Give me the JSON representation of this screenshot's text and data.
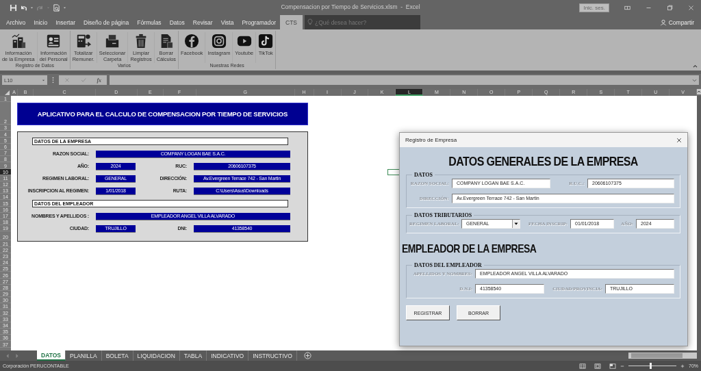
{
  "window": {
    "title": "Compensacion por Tiempo de Servicios.xlsm  -  Excel",
    "sign_in": "Inic. ses."
  },
  "menu_tabs": [
    {
      "label": "Archivo",
      "selected": false
    },
    {
      "label": "Inicio",
      "selected": false
    },
    {
      "label": "Insertar",
      "selected": false
    },
    {
      "label": "Diseño de página",
      "selected": false
    },
    {
      "label": "Fórmulas",
      "selected": false
    },
    {
      "label": "Datos",
      "selected": false
    },
    {
      "label": "Revisar",
      "selected": false
    },
    {
      "label": "Vista",
      "selected": false
    },
    {
      "label": "Programador",
      "selected": false
    },
    {
      "label": "CTS",
      "selected": true
    }
  ],
  "search": {
    "placeholder": "¿Qué desea hacer?"
  },
  "share": "Compartir",
  "ribbon": {
    "groups": [
      {
        "label": "Registro de Datos",
        "buttons": [
          {
            "lines": [
              "Información",
              "de la Empresa"
            ]
          },
          {
            "lines": [
              "Información",
              "del Personal"
            ]
          }
        ]
      },
      {
        "label": "Varios",
        "buttons": [
          {
            "lines": [
              "Totalizar",
              "Remuner."
            ]
          },
          {
            "lines": [
              "Seleccionar",
              "Carpeta"
            ]
          },
          {
            "lines": [
              "Limpiar",
              "Registros"
            ]
          },
          {
            "lines": [
              "Borrar",
              "Cálculos"
            ]
          }
        ]
      },
      {
        "label": "Nuestras Redes",
        "buttons": [
          {
            "lines": [
              "Facebook"
            ]
          },
          {
            "lines": [
              "Instagram"
            ]
          },
          {
            "lines": [
              "Youtube"
            ]
          },
          {
            "lines": [
              "TikTok"
            ]
          }
        ]
      }
    ]
  },
  "formula_bar": {
    "name_box": "L10",
    "function_label": "fx"
  },
  "sheet": {
    "columns": [
      {
        "label": "A",
        "selected": false
      },
      {
        "label": "B",
        "selected": false
      },
      {
        "label": "C",
        "selected": false
      },
      {
        "label": "D",
        "selected": false
      },
      {
        "label": "E",
        "selected": false
      },
      {
        "label": "F",
        "selected": false
      },
      {
        "label": "G",
        "selected": false
      },
      {
        "label": "H",
        "selected": false
      },
      {
        "label": "I",
        "selected": false
      },
      {
        "label": "J",
        "selected": false
      },
      {
        "label": "K",
        "selected": false
      },
      {
        "label": "L",
        "selected": true
      },
      {
        "label": "M",
        "selected": false
      },
      {
        "label": "N",
        "selected": false
      },
      {
        "label": "O",
        "selected": false
      },
      {
        "label": "P",
        "selected": false
      },
      {
        "label": "Q",
        "selected": false
      },
      {
        "label": "R",
        "selected": false
      },
      {
        "label": "S",
        "selected": false
      },
      {
        "label": "T",
        "selected": false
      },
      {
        "label": "U",
        "selected": false
      },
      {
        "label": "V",
        "selected": false
      }
    ],
    "rows": [
      {
        "label": "1",
        "selected": false
      },
      {
        "label": "2",
        "selected": false
      },
      {
        "label": "3",
        "selected": false
      },
      {
        "label": "4",
        "selected": false
      },
      {
        "label": "5",
        "selected": false
      },
      {
        "label": "6",
        "selected": false
      },
      {
        "label": "7",
        "selected": false
      },
      {
        "label": "8",
        "selected": false
      },
      {
        "label": "9",
        "selected": false
      },
      {
        "label": "10",
        "selected": true
      },
      {
        "label": "11",
        "selected": false
      },
      {
        "label": "12",
        "selected": false
      },
      {
        "label": "13",
        "selected": false
      },
      {
        "label": "14",
        "selected": false
      },
      {
        "label": "15",
        "selected": false
      },
      {
        "label": "16",
        "selected": false
      },
      {
        "label": "17",
        "selected": false
      },
      {
        "label": "18",
        "selected": false
      },
      {
        "label": "19",
        "selected": false
      },
      {
        "label": "20",
        "selected": false
      },
      {
        "label": "21",
        "selected": false
      },
      {
        "label": "22",
        "selected": false
      },
      {
        "label": "23",
        "selected": false
      },
      {
        "label": "24",
        "selected": false
      },
      {
        "label": "25",
        "selected": false
      },
      {
        "label": "26",
        "selected": false
      },
      {
        "label": "27",
        "selected": false
      },
      {
        "label": "28",
        "selected": false
      },
      {
        "label": "29",
        "selected": false
      },
      {
        "label": "30",
        "selected": false
      },
      {
        "label": "31",
        "selected": false
      },
      {
        "label": "32",
        "selected": false
      },
      {
        "label": "33",
        "selected": false
      },
      {
        "label": "34",
        "selected": false
      },
      {
        "label": "35",
        "selected": false
      },
      {
        "label": "36",
        "selected": false
      },
      {
        "label": "37",
        "selected": false
      }
    ],
    "banner": "APLICATIVO PARA EL CALCULO DE COMPENSACION POR TIEMPO DE SERVICIOS",
    "sections": [
      {
        "title": "DATOS DE LA EMPRESA",
        "rows": [
          [
            {
              "label": "RAZON SOCIAL:",
              "value": "COMPANY LOGAN BAE S.A.C."
            }
          ],
          [
            {
              "label": "AÑO:",
              "value": "2024"
            },
            {
              "label": "RUC:",
              "value": "20606107375"
            }
          ],
          [
            {
              "label": "REGIMEN LABORAL:",
              "value": "GENERAL"
            },
            {
              "label": "DIRECCIÓN:",
              "value": "Av.Evergreen Terrace 742 - San Martin"
            }
          ],
          [
            {
              "label": "INSCRIPCION AL REGIMEN:",
              "value": "1/01/2018"
            },
            {
              "label": "RUTA:",
              "value": "C:\\Users\\Asus\\Downloads"
            }
          ]
        ]
      },
      {
        "title": "DATOS DEL EMPLEADOR",
        "rows": [
          [
            {
              "label": "NOMBRES Y APELLIDOS :",
              "value": "EMPLEADOR ANGEL VILLA ALVARADO"
            }
          ],
          [
            {
              "label": "CIUDAD:",
              "value": "TRUJILLO"
            },
            {
              "label": "DNI:",
              "value": "41358540"
            }
          ]
        ]
      }
    ]
  },
  "dialog": {
    "title": "Registro de Empresa",
    "blocks": [
      {
        "kind": "heading",
        "text": "DATOS GENERALES DE LA EMPRESA"
      },
      {
        "kind": "group",
        "title": "DATOS",
        "rows": [
          [
            {
              "label": "RAZON SOCIAL:",
              "value": "COMPANY LOGAN BAE S.A.C.",
              "kind": "text"
            },
            {
              "label": "R.U.C.:",
              "value": "20606107375",
              "kind": "text"
            }
          ],
          [
            {
              "label": "DIRECCIÓN:",
              "value": "Av.Evergreen Terrace 742 - San Martin",
              "kind": "text"
            }
          ]
        ]
      },
      {
        "kind": "group",
        "title": "DATOS TRIBUTARIOS",
        "rows": [
          [
            {
              "label": "REGIMEN LABORAL:",
              "value": "GENERAL",
              "kind": "select"
            },
            {
              "label": "FECHA INSCRIP:",
              "value": "01/01/2018",
              "kind": "text"
            },
            {
              "label": "AÑO:",
              "value": "2024",
              "kind": "text"
            }
          ]
        ]
      },
      {
        "kind": "subheading",
        "text": "EMPLEADOR DE LA EMPRESA"
      },
      {
        "kind": "group",
        "title": "DATOS DEL EMPLEADOR",
        "rows": [
          [
            {
              "label": "APELLIDOS Y NOMBRES:",
              "value": "EMPLEADOR ANGEL VILLA ALVARADO",
              "kind": "text"
            }
          ],
          [
            {
              "label": "D.N.I:",
              "value": "41358540",
              "kind": "text"
            },
            {
              "label": "CIUDAD/PROVINCIA:",
              "value": "TRUJILLO",
              "kind": "text"
            }
          ]
        ]
      }
    ],
    "buttons": [
      "REGISTRAR",
      "BORRAR"
    ]
  },
  "sheet_tabs": [
    {
      "label": "DATOS",
      "selected": true
    },
    {
      "label": "PLANILLA",
      "selected": false
    },
    {
      "label": "BOLETA",
      "selected": false
    },
    {
      "label": "LIQUIDACION",
      "selected": false
    },
    {
      "label": "TABLA",
      "selected": false
    },
    {
      "label": "INDICATIVO",
      "selected": false
    },
    {
      "label": "INSTRUCTIVO",
      "selected": false
    }
  ],
  "status_bar": {
    "text": "Corporación PERUCONTABLE",
    "zoom": "70%",
    "zoom_slider": {
      "level": 0.47
    }
  }
}
